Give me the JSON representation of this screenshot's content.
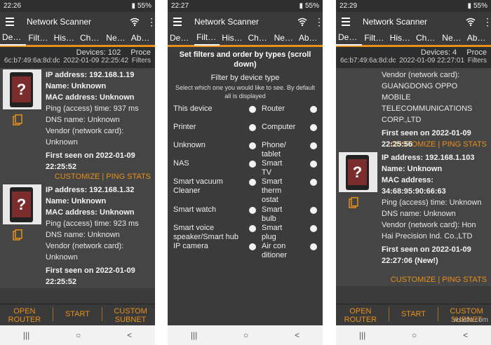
{
  "phones": [
    {
      "status": {
        "time": "22:26",
        "battery": "55%"
      },
      "title": "Network Scanner",
      "tabs": [
        "Device",
        "Filters",
        "Histo..",
        "Char..",
        "Netw..",
        "About"
      ],
      "info": {
        "devices": "Devices: 102",
        "proc": "Proce",
        "mac": "6c:b7:49:6a:8d:dc",
        "datetime": "2022-01-09 22:25:42",
        "filters": "Filters"
      },
      "devices": [
        {
          "ip": "IP address: 192.168.1.19",
          "name": "Name: Unknown",
          "mac": "MAC address: Unknown",
          "ping": "Ping (access) time: 937  ms",
          "dns": "DNS name: Unknown",
          "vendor": "Vendor (network card): Unknown",
          "seen": "First seen on 2022-01-09 22:25:52"
        },
        {
          "ip": "IP address: 192.168.1.32",
          "name": "Name: Unknown",
          "mac": "MAC address: Unknown",
          "ping": "Ping (access) time: 923  ms",
          "dns": "DNS name: Unknown",
          "vendor": "Vendor (network card): Unknown",
          "seen": "First seen on 2022-01-09 22:25:52"
        }
      ],
      "actions": {
        "customize": "CUSTOMIZE",
        "ping": "PING STATS"
      },
      "bottom": {
        "open_router": "OPEN ROUTER",
        "start": "START",
        "custom_subnet": "CUSTOM SUBNET"
      }
    },
    {
      "status": {
        "time": "22:27",
        "battery": "55%"
      },
      "title": "Network Scanner",
      "tabs": [
        "Devic..",
        "Filters",
        "Histo..",
        "Char..",
        "Netw..",
        "About"
      ],
      "filter": {
        "heading": "Set filters and order by types (scroll down)",
        "sub": "Filter by device type",
        "desc": "Select which one you would like to see. By default all is displayed",
        "left": [
          "This device",
          "Printer",
          "Unknown",
          "NAS",
          "Smart vacuum Cleaner",
          "Smart watch",
          "Smart voice speaker/Smart hub",
          "IP camera"
        ],
        "right": [
          "Router",
          "Computer",
          "Phone/tablet",
          "Smart TV",
          "Smart thermostat",
          "Smart bulb",
          "Smart plug",
          "Air conditioner"
        ]
      }
    },
    {
      "status": {
        "time": "22:29",
        "battery": "55%"
      },
      "title": "Network Scanner",
      "tabs": [
        "Device",
        "Filters",
        "Histo..",
        "Char..",
        "Netw..",
        "About"
      ],
      "info": {
        "devices": "Devices: 4",
        "proc": "Proce",
        "mac": "6c:b7:49:6a:8d:dc",
        "datetime": "2022-01-09 22:27:01",
        "filters": "Filters"
      },
      "partial": {
        "vendor": "Vendor (network card): GUANGDONG OPPO MOBILE TELECOMMUNICATIONS CORP.,LTD",
        "seen": "First seen on 2022-01-09 22:25:56"
      },
      "devices": [
        {
          "ip": "IP address: 192.168.1.103",
          "name": "Name: Unknown",
          "mac": "MAC address: 34:68:95:90:66:63",
          "ping": "Ping (access) time: Unknown",
          "dns": "DNS name: Unknown",
          "vendor": "Vendor (network card): Hon Hai Precision Ind. Co.,LTD",
          "seen": "First seen on 2022-01-09 22:27:06 (New!)"
        }
      ],
      "actions": {
        "customize": "CUSTOMIZE",
        "ping": "PING STATS"
      },
      "bottom": {
        "open_router": "OPEN ROUTER",
        "start": "START",
        "custom_subnet": "CUSTOM SUBNET"
      },
      "watermark": "wsxdn.com"
    }
  ],
  "nav": {
    "recents": "|||",
    "home": "○",
    "back": "<"
  },
  "colors": {
    "accent": "#e8901a",
    "bg": "#3b3b3b"
  }
}
